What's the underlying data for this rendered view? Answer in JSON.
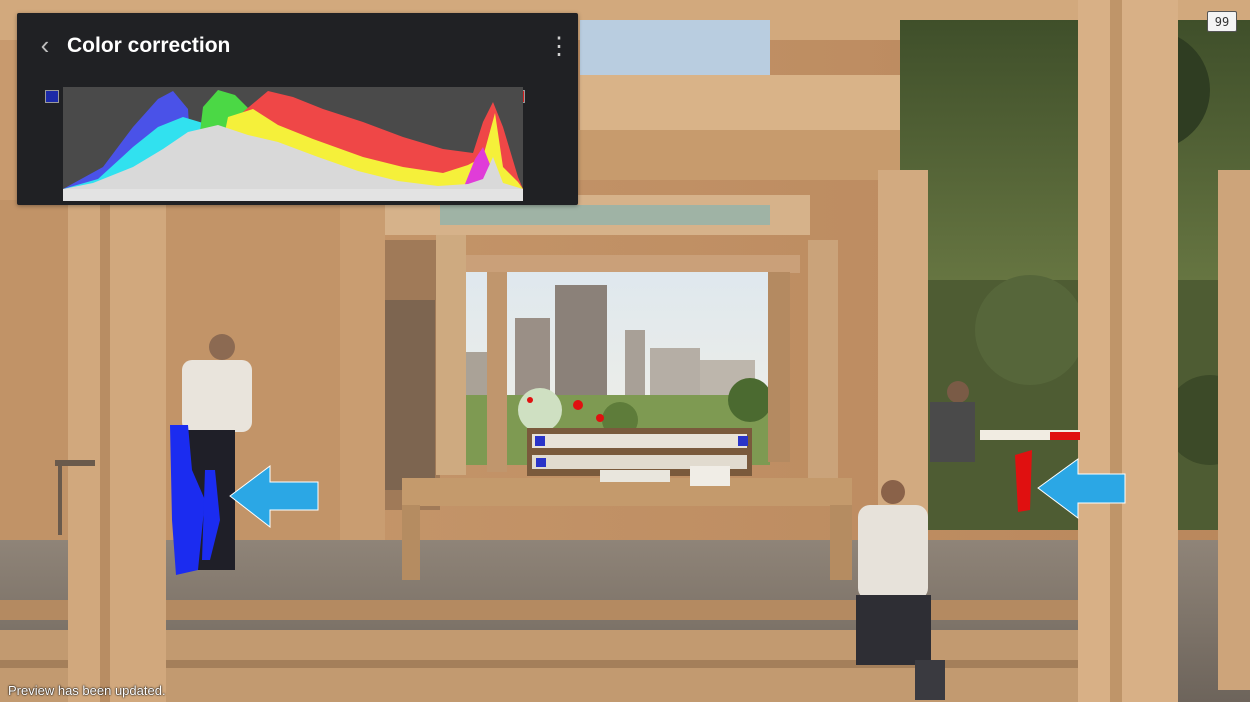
{
  "panel": {
    "title": "Color correction",
    "back_icon": "chevron-left-icon",
    "menu_icon": "more-vertical-icon",
    "handle_left_color": "#1c2aa8",
    "handle_right_color": "#d21e1e",
    "histogram_layers": [
      {
        "name": "blue",
        "color": "#4a52e8"
      },
      {
        "name": "cyan",
        "color": "#31e1ef"
      },
      {
        "name": "green",
        "color": "#4bd845"
      },
      {
        "name": "red",
        "color": "#ef4747"
      },
      {
        "name": "yellow",
        "color": "#f5f03a"
      },
      {
        "name": "magenta",
        "color": "#e03cd8"
      },
      {
        "name": "luminance",
        "color": "#d9d9d9"
      }
    ]
  },
  "status": {
    "text": "Preview has been updated."
  },
  "corner_badge": {
    "text": "99"
  },
  "annotations": {
    "arrow_color": "#2ba7e5",
    "highlight_blue": "#1b2cf0",
    "highlight_red": "#e01010"
  }
}
